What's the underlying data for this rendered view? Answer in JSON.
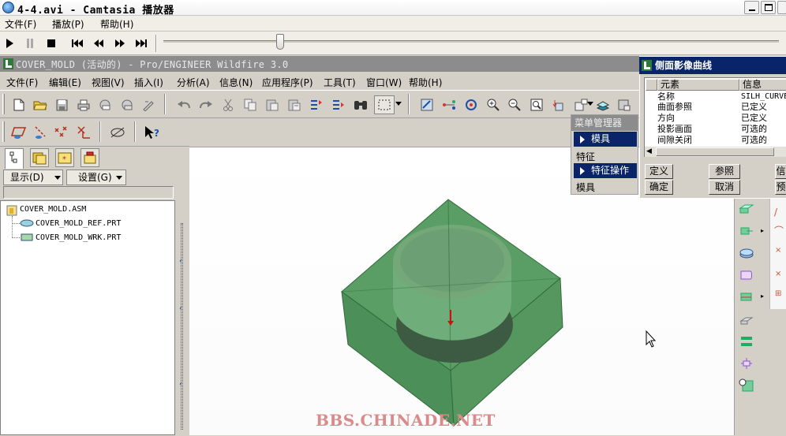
{
  "player": {
    "title": "4-4.avi - Camtasia 播放器",
    "menu": [
      "文件(F)",
      "播放(P)",
      "帮助(H)"
    ],
    "progress": 0.19
  },
  "proe": {
    "title": "COVER_MOLD (活动的) - Pro/ENGINEER Wildfire 3.0",
    "menu": [
      "文件(F)",
      "编辑(E)",
      "视图(V)",
      "插入(I)",
      "分析(A)",
      "信息(N)",
      "应用程序(P)",
      "工具(T)",
      "窗口(W)",
      "帮助(H)"
    ]
  },
  "tree": {
    "display_label": "显示(D)",
    "settings_label": "设置(G)",
    "nodes": [
      "COVER_MOLD.ASM",
      "COVER_MOLD_REF.PRT",
      "COVER_MOLD_WRK.PRT"
    ]
  },
  "menu_manager": {
    "title": "菜单管理器",
    "items": [
      "模具",
      "特征",
      "特征操作",
      "模具"
    ]
  },
  "dialog": {
    "title": "侧面影像曲线",
    "columns": [
      "元素",
      "信息"
    ],
    "rows": [
      {
        "element": "名称",
        "info": "SILH_CURVE"
      },
      {
        "element": "曲面参照",
        "info": "已定义"
      },
      {
        "element": "方向",
        "info": "已定义"
      },
      {
        "element": "投影画面",
        "info": "可选的"
      },
      {
        "element": "间隙关闭",
        "info": "可选的"
      }
    ],
    "buttons": [
      "定义",
      "参照",
      "信",
      "确定",
      "取消",
      "预"
    ]
  },
  "watermark": "BBS.CHINADE.NET",
  "colors": {
    "model_green": "#4f9c60",
    "selection_blue": "#0a246a",
    "proe_title_gray": "#8c8c8c"
  }
}
